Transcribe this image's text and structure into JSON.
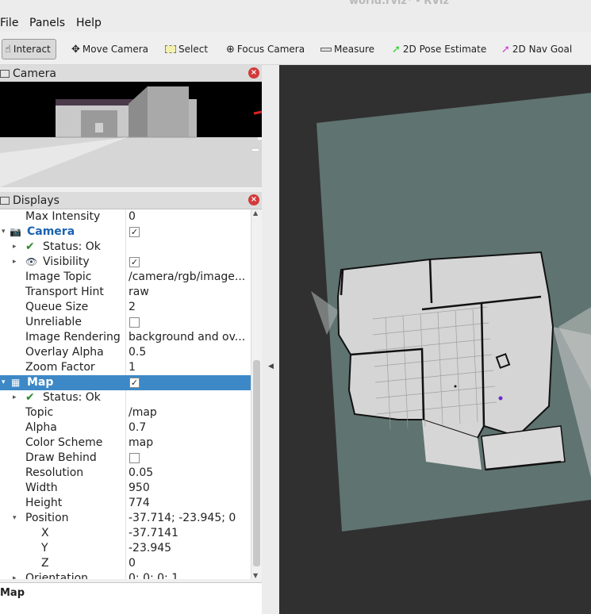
{
  "window": {
    "title": "world.rviz* - RViz"
  },
  "menu": {
    "file": "File",
    "panels": "Panels",
    "help": "Help"
  },
  "toolbar": {
    "tools": [
      {
        "label": "Interact",
        "icon": "hand-icon",
        "active": true
      },
      {
        "label": "Move Camera",
        "icon": "move-icon"
      },
      {
        "label": "Select",
        "icon": "select-icon"
      },
      {
        "label": "Focus Camera",
        "icon": "crosshair-icon"
      },
      {
        "label": "Measure",
        "icon": "ruler-icon"
      },
      {
        "label": "2D Pose Estimate",
        "icon": "green-arrow-icon",
        "color": "#2fcf2f"
      },
      {
        "label": "2D Nav Goal",
        "icon": "magenta-arrow-icon",
        "color": "#d43ad4"
      }
    ]
  },
  "camera_panel": {
    "title": "Camera"
  },
  "displays_panel": {
    "title": "Displays",
    "rows": [
      {
        "name": "Max Intensity",
        "value": "0"
      },
      {
        "name": "Camera",
        "value": "",
        "checkbox": true,
        "checked": true,
        "icon": "camera-icon",
        "expanded": true
      },
      {
        "name": "Status: Ok",
        "value": "",
        "status": true
      },
      {
        "name": "Visibility",
        "value": "",
        "checkbox": true,
        "checked": true,
        "icon": "eye-icon"
      },
      {
        "name": "Image Topic",
        "value": "/camera/rgb/image..."
      },
      {
        "name": "Transport Hint",
        "value": "raw"
      },
      {
        "name": "Queue Size",
        "value": "2"
      },
      {
        "name": "Unreliable",
        "value": "",
        "checkbox": true,
        "checked": false
      },
      {
        "name": "Image Rendering",
        "value": "background and ov..."
      },
      {
        "name": "Overlay Alpha",
        "value": "0.5"
      },
      {
        "name": "Zoom Factor",
        "value": "1"
      },
      {
        "name": "Map",
        "value": "",
        "checkbox": true,
        "checked": true,
        "icon": "map-icon",
        "selected": true,
        "expanded": true
      },
      {
        "name": "Status: Ok",
        "value": "",
        "status": true
      },
      {
        "name": "Topic",
        "value": "/map"
      },
      {
        "name": "Alpha",
        "value": "0.7"
      },
      {
        "name": "Color Scheme",
        "value": "map"
      },
      {
        "name": "Draw Behind",
        "value": "",
        "checkbox": true,
        "checked": false
      },
      {
        "name": "Resolution",
        "value": "0.05"
      },
      {
        "name": "Width",
        "value": "950"
      },
      {
        "name": "Height",
        "value": "774"
      },
      {
        "name": "Position",
        "value": "-37.714; -23.945; 0",
        "expanded": true
      },
      {
        "name": "X",
        "value": "-37.7141"
      },
      {
        "name": "Y",
        "value": "-23.945"
      },
      {
        "name": "Z",
        "value": "0"
      },
      {
        "name": "Orientation",
        "value": "0; 0; 0; 1"
      }
    ]
  },
  "description": {
    "title": "Map"
  },
  "colors": {
    "selection": "#3d88c6",
    "view_background": "#303030",
    "map_unknown": "#5f7370",
    "map_free": "#d5d5d5",
    "map_occupied": "#111111"
  }
}
